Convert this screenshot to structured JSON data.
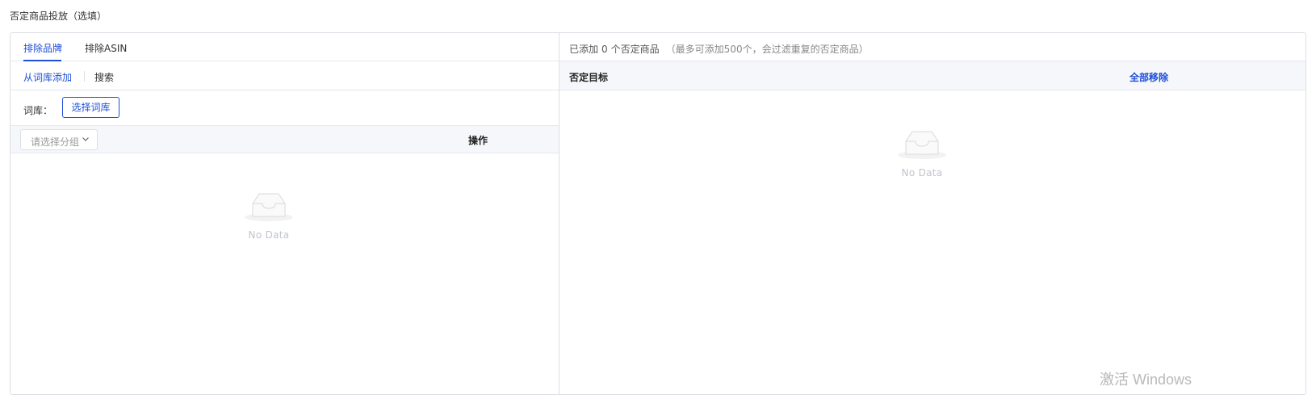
{
  "section_title": "否定商品投放（选填）",
  "left": {
    "tabs": [
      {
        "label": "排除品牌",
        "active": true
      },
      {
        "label": "排除ASIN",
        "active": false
      }
    ],
    "subtabs": [
      {
        "label": "从词库添加",
        "active": true
      },
      {
        "label": "搜索",
        "active": false
      }
    ],
    "library_label": "词库：",
    "select_library_button": "选择词库",
    "group_select_placeholder": "请选择分组",
    "operations_header": "操作",
    "empty_text": "No Data"
  },
  "right": {
    "added_prefix": "已添加",
    "added_count": "0",
    "added_suffix": "个否定商品",
    "hint": "（最多可添加500个，会过滤重复的否定商品）",
    "column_target": "否定目标",
    "remove_all": "全部移除",
    "empty_text": "No Data"
  },
  "watermark": "激活 Windows",
  "colors": {
    "accent": "#1f4fd8",
    "border": "#dcdfe6",
    "header_bg": "#f5f7fa",
    "empty_text": "#c0c4cc"
  }
}
